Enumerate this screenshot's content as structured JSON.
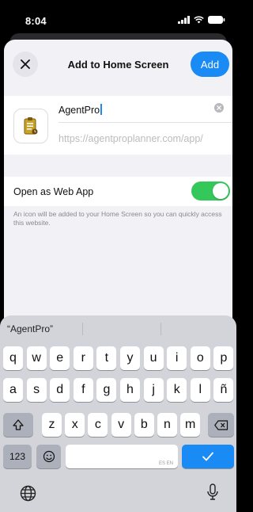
{
  "status_bar": {
    "time": "8:04"
  },
  "nav": {
    "title": "Add to Home Screen",
    "add_label": "Add"
  },
  "app": {
    "name": "AgentPro",
    "url": "https://agentproplanner.com/app/"
  },
  "web_app_row": {
    "label": "Open as Web App",
    "toggle_on": true
  },
  "helper_text": "An icon will be added to your Home Screen so you can quickly access this website.",
  "keyboard": {
    "suggestions": [
      "“AgentPro”",
      "",
      ""
    ],
    "row1": [
      "q",
      "w",
      "e",
      "r",
      "t",
      "y",
      "u",
      "i",
      "o",
      "p"
    ],
    "row2": [
      "a",
      "s",
      "d",
      "f",
      "g",
      "h",
      "j",
      "k",
      "l",
      "ñ"
    ],
    "row3": [
      "z",
      "x",
      "c",
      "v",
      "b",
      "n",
      "m"
    ],
    "numbers_label": "123",
    "space_hint": "ES EN",
    "return_icon": "checkmark-icon"
  },
  "colors": {
    "accent": "#1a8af5",
    "toggle": "#34c759"
  }
}
